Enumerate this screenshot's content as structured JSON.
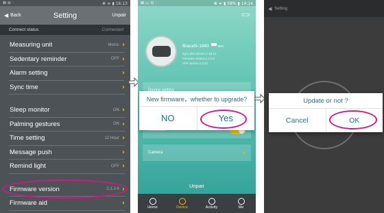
{
  "panel1": {
    "status_left": "⊠ ⊚ ·",
    "status_right": "✻ ᯤ ▮ 16:13",
    "back_label": "Back",
    "title": "Setting",
    "unpair_label": "Unpair",
    "connect_label": "Connect status",
    "connect_value": "Connected",
    "group1": [
      {
        "label": "Measuring unit",
        "value": "Metric"
      },
      {
        "label": "Sedentary reminder",
        "value": "OFF"
      },
      {
        "label": "Alarm setting",
        "value": ""
      },
      {
        "label": "Sync time",
        "value": ""
      }
    ],
    "group2": [
      {
        "label": "Sleep monitor",
        "value": "ON"
      },
      {
        "label": "Palming gestures",
        "value": "ON"
      },
      {
        "label": "Time setting",
        "value": "12 Hour"
      },
      {
        "label": "Message push",
        "value": ""
      },
      {
        "label": "Remind light",
        "value": "OFF"
      }
    ],
    "group3": [
      {
        "label": "Firmware version",
        "value": "2.1.2.6"
      },
      {
        "label": "Firmware aid",
        "value": ""
      }
    ]
  },
  "panel2": {
    "status_left": "⊠ ▭ ⊡ ·",
    "status_right": "✻ ᯤ ▮ 58% ▮ 14:14",
    "top_icon": "link-icon",
    "device_name": "Bracel5-1840",
    "battery": "90%",
    "sync_time": "Sync time:28-04-17 02:14",
    "firmware_version": "Firmware version:2.1.2.3",
    "app_version": "APP version:1.0.10",
    "menu_partial_1": "Device setting",
    "menu_partial_2": "Reminder",
    "camera_label": "Camera",
    "dialog_message": "New firmware，whether to upgrade?",
    "dialog_no": "NO",
    "dialog_yes": "Yes",
    "unpair_label": "Unpair",
    "nav": [
      {
        "label": "Home",
        "icon": "clock-icon"
      },
      {
        "label": "Device",
        "icon": "device-icon"
      },
      {
        "label": "Activity",
        "icon": "activity-icon"
      },
      {
        "label": "Me",
        "icon": "person-icon"
      }
    ]
  },
  "panel3": {
    "top_label": "Setting",
    "dialog_message": "Update or not ?",
    "dialog_cancel": "Cancel",
    "dialog_ok": "OK"
  },
  "colors": {
    "highlight": "#d6158a",
    "accent": "#f2c200",
    "dialog_text": "#1e6f86"
  }
}
